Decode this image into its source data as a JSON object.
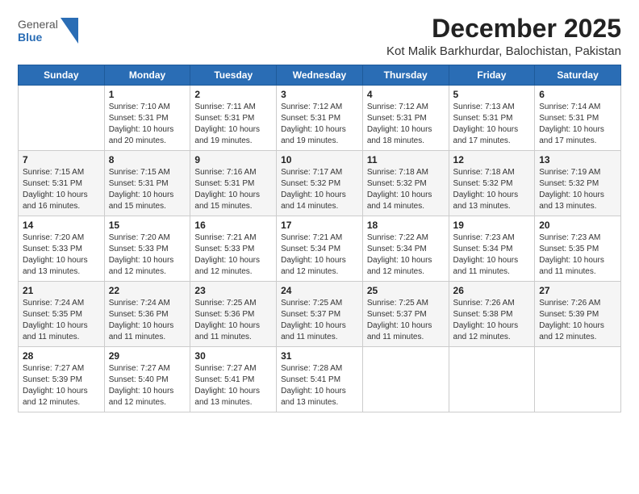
{
  "logo": {
    "general": "General",
    "blue": "Blue"
  },
  "title": "December 2025",
  "subtitle": "Kot Malik Barkhurdar, Balochistan, Pakistan",
  "weekdays": [
    "Sunday",
    "Monday",
    "Tuesday",
    "Wednesday",
    "Thursday",
    "Friday",
    "Saturday"
  ],
  "weeks": [
    [
      {
        "day": "",
        "info": ""
      },
      {
        "day": "1",
        "info": "Sunrise: 7:10 AM\nSunset: 5:31 PM\nDaylight: 10 hours\nand 20 minutes."
      },
      {
        "day": "2",
        "info": "Sunrise: 7:11 AM\nSunset: 5:31 PM\nDaylight: 10 hours\nand 19 minutes."
      },
      {
        "day": "3",
        "info": "Sunrise: 7:12 AM\nSunset: 5:31 PM\nDaylight: 10 hours\nand 19 minutes."
      },
      {
        "day": "4",
        "info": "Sunrise: 7:12 AM\nSunset: 5:31 PM\nDaylight: 10 hours\nand 18 minutes."
      },
      {
        "day": "5",
        "info": "Sunrise: 7:13 AM\nSunset: 5:31 PM\nDaylight: 10 hours\nand 17 minutes."
      },
      {
        "day": "6",
        "info": "Sunrise: 7:14 AM\nSunset: 5:31 PM\nDaylight: 10 hours\nand 17 minutes."
      }
    ],
    [
      {
        "day": "7",
        "info": "Sunrise: 7:15 AM\nSunset: 5:31 PM\nDaylight: 10 hours\nand 16 minutes."
      },
      {
        "day": "8",
        "info": "Sunrise: 7:15 AM\nSunset: 5:31 PM\nDaylight: 10 hours\nand 15 minutes."
      },
      {
        "day": "9",
        "info": "Sunrise: 7:16 AM\nSunset: 5:31 PM\nDaylight: 10 hours\nand 15 minutes."
      },
      {
        "day": "10",
        "info": "Sunrise: 7:17 AM\nSunset: 5:32 PM\nDaylight: 10 hours\nand 14 minutes."
      },
      {
        "day": "11",
        "info": "Sunrise: 7:18 AM\nSunset: 5:32 PM\nDaylight: 10 hours\nand 14 minutes."
      },
      {
        "day": "12",
        "info": "Sunrise: 7:18 AM\nSunset: 5:32 PM\nDaylight: 10 hours\nand 13 minutes."
      },
      {
        "day": "13",
        "info": "Sunrise: 7:19 AM\nSunset: 5:32 PM\nDaylight: 10 hours\nand 13 minutes."
      }
    ],
    [
      {
        "day": "14",
        "info": "Sunrise: 7:20 AM\nSunset: 5:33 PM\nDaylight: 10 hours\nand 13 minutes."
      },
      {
        "day": "15",
        "info": "Sunrise: 7:20 AM\nSunset: 5:33 PM\nDaylight: 10 hours\nand 12 minutes."
      },
      {
        "day": "16",
        "info": "Sunrise: 7:21 AM\nSunset: 5:33 PM\nDaylight: 10 hours\nand 12 minutes."
      },
      {
        "day": "17",
        "info": "Sunrise: 7:21 AM\nSunset: 5:34 PM\nDaylight: 10 hours\nand 12 minutes."
      },
      {
        "day": "18",
        "info": "Sunrise: 7:22 AM\nSunset: 5:34 PM\nDaylight: 10 hours\nand 12 minutes."
      },
      {
        "day": "19",
        "info": "Sunrise: 7:23 AM\nSunset: 5:34 PM\nDaylight: 10 hours\nand 11 minutes."
      },
      {
        "day": "20",
        "info": "Sunrise: 7:23 AM\nSunset: 5:35 PM\nDaylight: 10 hours\nand 11 minutes."
      }
    ],
    [
      {
        "day": "21",
        "info": "Sunrise: 7:24 AM\nSunset: 5:35 PM\nDaylight: 10 hours\nand 11 minutes."
      },
      {
        "day": "22",
        "info": "Sunrise: 7:24 AM\nSunset: 5:36 PM\nDaylight: 10 hours\nand 11 minutes."
      },
      {
        "day": "23",
        "info": "Sunrise: 7:25 AM\nSunset: 5:36 PM\nDaylight: 10 hours\nand 11 minutes."
      },
      {
        "day": "24",
        "info": "Sunrise: 7:25 AM\nSunset: 5:37 PM\nDaylight: 10 hours\nand 11 minutes."
      },
      {
        "day": "25",
        "info": "Sunrise: 7:25 AM\nSunset: 5:37 PM\nDaylight: 10 hours\nand 11 minutes."
      },
      {
        "day": "26",
        "info": "Sunrise: 7:26 AM\nSunset: 5:38 PM\nDaylight: 10 hours\nand 12 minutes."
      },
      {
        "day": "27",
        "info": "Sunrise: 7:26 AM\nSunset: 5:39 PM\nDaylight: 10 hours\nand 12 minutes."
      }
    ],
    [
      {
        "day": "28",
        "info": "Sunrise: 7:27 AM\nSunset: 5:39 PM\nDaylight: 10 hours\nand 12 minutes."
      },
      {
        "day": "29",
        "info": "Sunrise: 7:27 AM\nSunset: 5:40 PM\nDaylight: 10 hours\nand 12 minutes."
      },
      {
        "day": "30",
        "info": "Sunrise: 7:27 AM\nSunset: 5:41 PM\nDaylight: 10 hours\nand 13 minutes."
      },
      {
        "day": "31",
        "info": "Sunrise: 7:28 AM\nSunset: 5:41 PM\nDaylight: 10 hours\nand 13 minutes."
      },
      {
        "day": "",
        "info": ""
      },
      {
        "day": "",
        "info": ""
      },
      {
        "day": "",
        "info": ""
      }
    ]
  ]
}
